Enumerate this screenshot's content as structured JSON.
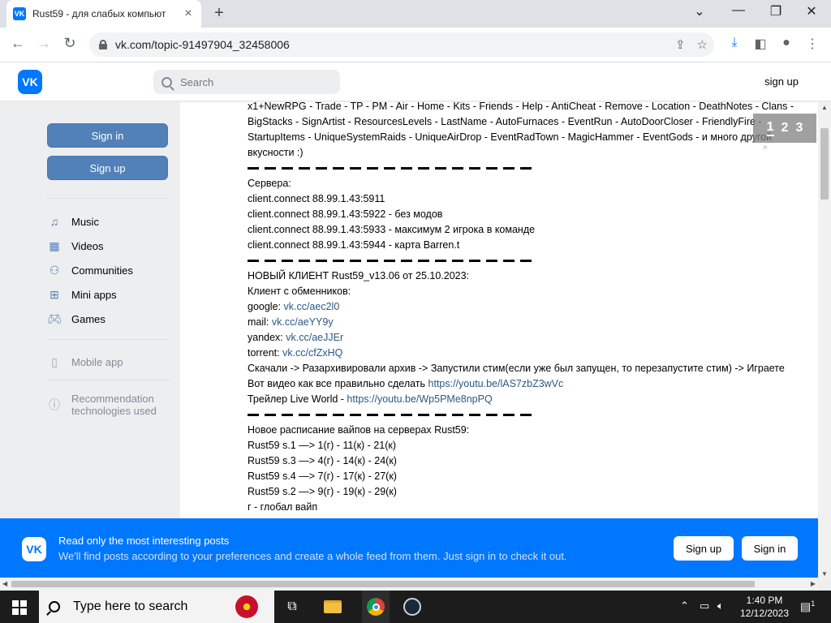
{
  "browser": {
    "tab_title": "Rust59 - для слабых компьют",
    "tab_favicon": "VK",
    "url": "vk.com/topic-91497904_32458006"
  },
  "vk_header": {
    "logo": "VK",
    "search_placeholder": "Search",
    "signup_link": "sign up"
  },
  "sidebar": {
    "sign_in": "Sign in",
    "sign_up": "Sign up",
    "items": [
      {
        "label": "Music",
        "icon": "music-icon"
      },
      {
        "label": "Videos",
        "icon": "videos-icon"
      },
      {
        "label": "Communities",
        "icon": "communities-icon"
      },
      {
        "label": "Mini apps",
        "icon": "mini-apps-icon"
      },
      {
        "label": "Games",
        "icon": "games-icon"
      }
    ],
    "mobile_app": "Mobile app",
    "recommendation_line1": "Recommendation",
    "recommendation_line2": "technologies used"
  },
  "post": {
    "plugins_line1": "x1+NewRPG - Trade - TP - PM - Air - Home - Kits - Friends - Help - AntiCheat - Remove - Location - DeathNotes - Clans -",
    "plugins_line2": "BigStacks - SignArtist - ResourcesLevels - LastName - AutoFurnaces - EventRun - AutoDoorCloser - FriendlyFire -",
    "plugins_line3": "StartupItems - UniqueSystemRaids - UniqueAirDrop - EventRadTown - MagicHammer - EventGods - и много другой",
    "plugins_line4": "вкусности :)",
    "servers_title": "Сервера:",
    "servers": [
      "client.connect 88.99.1.43:5911",
      "client.connect 88.99.1.43:5922 - без модов",
      "client.connect 88.99.1.43:5933 - максимум 2 игрока в команде",
      "client.connect 88.99.1.43:5944 - карта Barren.t"
    ],
    "client_title": "НОВЫЙ КЛИЕНТ Rust59_v13.06 от 25.10.2023:",
    "client_sub": "Клиент с обменников:",
    "mirrors": [
      {
        "name": "google: ",
        "link": "vk.cc/aec2l0"
      },
      {
        "name": "mail: ",
        "link": "vk.cc/aeYY9y"
      },
      {
        "name": "yandex: ",
        "link": "vk.cc/aeJJEr"
      },
      {
        "name": "torrent: ",
        "link": "vk.cc/cfZxHQ"
      }
    ],
    "instructions": "Скачали -> Разархивировали архив -> Запустили стим(если уже был запущен, то перезапустите стим) -> Играете",
    "video_text": "Вот видео как все правильно сделать ",
    "video_link": "https://youtu.be/lAS7zbZ3wVc",
    "trailer_text": "Трейлер Live World - ",
    "trailer_link": "https://youtu.be/Wp5PMe8npPQ",
    "wipe_title": "Новое расписание вайпов на серверах Rust59:",
    "wipes": [
      "Rust59 s.1 —> 1(г) - 11(к) - 21(к)",
      "Rust59 s.3 —> 4(г) - 14(к) - 24(к)",
      "Rust59 s.4 —> 7(г) - 17(к) - 27(к)",
      "Rust59 s.2 —> 9(г) - 19(к) - 29(к)"
    ],
    "wipe_note": "г - глобал вайп"
  },
  "pager": {
    "p1": "1",
    "p2": "2",
    "p3": "3",
    "more": "»"
  },
  "banner": {
    "logo": "VK",
    "title": "Read only the most interesting posts",
    "subtitle": "We'll find posts according to your preferences and create a whole feed from them. Just sign in to check it out.",
    "sign_up": "Sign up",
    "sign_in": "Sign in"
  },
  "taskbar": {
    "search_placeholder": "Type here to search",
    "time": "1:40 PM",
    "date": "12/12/2023",
    "notifications": "1"
  }
}
